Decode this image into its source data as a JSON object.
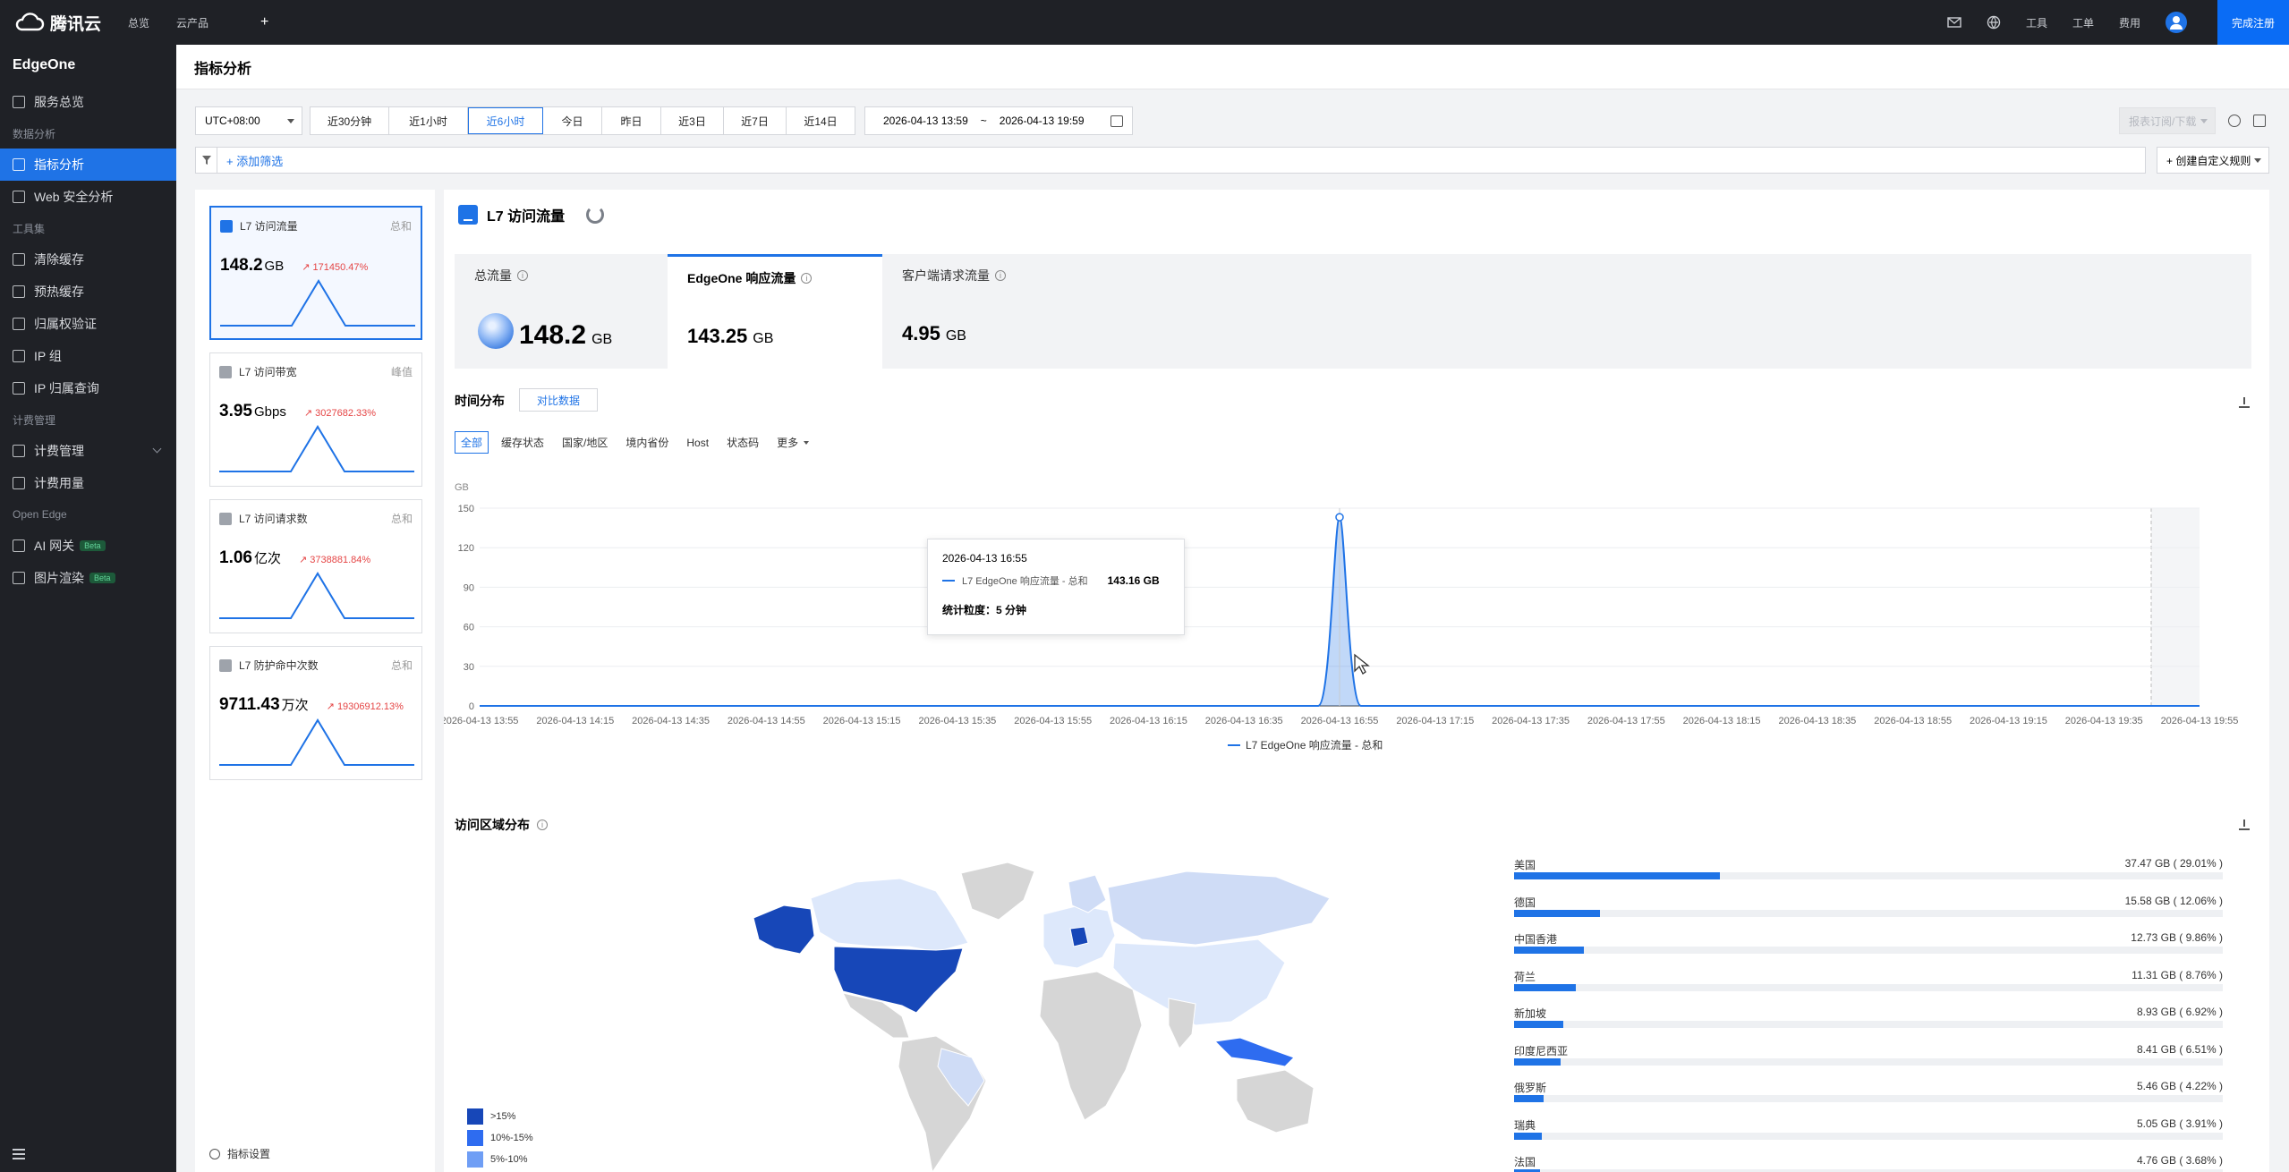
{
  "topbar": {
    "brand": "腾讯云",
    "nav": [
      "总览",
      "云产品"
    ],
    "plus": "+",
    "right_items": [
      "工具",
      "工单",
      "费用"
    ],
    "register_label": "完成注册",
    "icons": [
      "mail-icon",
      "globe-icon",
      "avatar-icon"
    ]
  },
  "sidebar": {
    "product": "EdgeOne",
    "items": [
      {
        "type": "item",
        "label": "服务总览",
        "icon": "grid-icon"
      },
      {
        "type": "group",
        "label": "数据分析"
      },
      {
        "type": "item",
        "label": "指标分析",
        "icon": "monitor-icon",
        "active": true
      },
      {
        "type": "item",
        "label": "Web 安全分析",
        "icon": "shield-icon"
      },
      {
        "type": "group",
        "label": "工具集"
      },
      {
        "type": "item",
        "label": "清除缓存",
        "icon": "clear-cache-icon"
      },
      {
        "type": "item",
        "label": "预热缓存",
        "icon": "prefetch-icon"
      },
      {
        "type": "item",
        "label": "归属权验证",
        "icon": "verify-icon"
      },
      {
        "type": "item",
        "label": "IP 组",
        "icon": "ip-group-icon"
      },
      {
        "type": "item",
        "label": "IP 归属查询",
        "icon": "search-icon"
      },
      {
        "type": "group",
        "label": "计费管理"
      },
      {
        "type": "item",
        "label": "计费管理",
        "icon": "billing-icon",
        "expandable": true
      },
      {
        "type": "item",
        "label": "计费用量",
        "icon": "usage-icon"
      },
      {
        "type": "group",
        "label": "Open Edge"
      },
      {
        "type": "item",
        "label": "AI 网关",
        "icon": "ai-gateway-icon",
        "badge": "Beta"
      },
      {
        "type": "item",
        "label": "图片渲染",
        "icon": "image-render-icon",
        "badge": "Beta"
      }
    ]
  },
  "page": {
    "title": "指标分析"
  },
  "filters": {
    "timezone": "UTC+08:00",
    "ranges": [
      "近30分钟",
      "近1小时",
      "近6小时",
      "今日",
      "昨日",
      "近3日",
      "近7日",
      "近14日"
    ],
    "active_range": "近6小时",
    "date_start": "2026-04-13 13:59",
    "date_sep": "~",
    "date_end": "2026-04-13 19:59",
    "export_label": "报表订阅/下载",
    "add_filter_label": "添加筛选",
    "custom_rule_label": "+ 创建自定义规则"
  },
  "metric_cards": [
    {
      "title": "L7 访问流量",
      "agg": "总和",
      "value": "148.2",
      "unit": "GB",
      "delta": "171450.47%",
      "active": true
    },
    {
      "title": "L7 访问带宽",
      "agg": "峰值",
      "value": "3.95",
      "unit": "Gbps",
      "delta": "3027682.33%"
    },
    {
      "title": "L7 访问请求数",
      "agg": "总和",
      "value": "1.06",
      "unit": "亿次",
      "delta": "3738881.84%"
    },
    {
      "title": "L7 防护命中次数",
      "agg": "总和",
      "value": "9711.43",
      "unit": "万次",
      "delta": "19306912.13%"
    }
  ],
  "cards_footer": "指标设置",
  "main": {
    "title": "L7 访问流量",
    "summary": [
      {
        "label": "总流量",
        "value": "148.2",
        "unit": "GB"
      },
      {
        "label": "EdgeOne 响应流量",
        "value": "143.25",
        "unit": "GB",
        "active": true
      },
      {
        "label": "客户端请求流量",
        "value": "4.95",
        "unit": "GB"
      }
    ],
    "time_section_title": "时间分布",
    "compare_label": "对比数据",
    "dimension_tabs": [
      "全部",
      "缓存状态",
      "国家/地区",
      "境内省份",
      "Host",
      "状态码"
    ],
    "more_label": "更多",
    "region_section_title": "访问区域分布"
  },
  "chart_data": {
    "type": "line",
    "ylabel": "GB",
    "ylim": [
      0,
      150
    ],
    "yticks": [
      0,
      30,
      60,
      90,
      120,
      150
    ],
    "x": [
      "2026-04-13 13:55",
      "2026-04-13 14:15",
      "2026-04-13 14:35",
      "2026-04-13 14:55",
      "2026-04-13 15:15",
      "2026-04-13 15:35",
      "2026-04-13 15:55",
      "2026-04-13 16:15",
      "2026-04-13 16:35",
      "2026-04-13 16:55",
      "2026-04-13 17:15",
      "2026-04-13 17:35",
      "2026-04-13 17:55",
      "2026-04-13 18:15",
      "2026-04-13 18:35",
      "2026-04-13 18:55",
      "2026-04-13 19:15",
      "2026-04-13 19:35",
      "2026-04-13 19:55"
    ],
    "series": [
      {
        "name": "L7 EdgeOne 响应流量 - 总和",
        "values": [
          0,
          0,
          0,
          0,
          0,
          0,
          0,
          0,
          0,
          143.16,
          0,
          0,
          0,
          0,
          0,
          0,
          0,
          0,
          0
        ]
      }
    ],
    "tooltip": {
      "time": "2026-04-13 16:55",
      "series": "L7 EdgeOne 响应流量 - 总和",
      "value": "143.16 GB",
      "granularity": "统计粒度：5 分钟"
    },
    "legend": "L7 EdgeOne 响应流量 - 总和"
  },
  "map_legend": [
    {
      "label": ">15%",
      "color": "#1747b8"
    },
    {
      "label": "10%-15%",
      "color": "#2e6cf0"
    },
    {
      "label": "5%-10%",
      "color": "#6f9ef5"
    }
  ],
  "regions": [
    {
      "name": "美国",
      "value": "37.47 GB ( 29.01% )",
      "pct": 29.01
    },
    {
      "name": "德国",
      "value": "15.58 GB ( 12.06% )",
      "pct": 12.06
    },
    {
      "name": "中国香港",
      "value": "12.73 GB ( 9.86% )",
      "pct": 9.86
    },
    {
      "name": "荷兰",
      "value": "11.31 GB ( 8.76% )",
      "pct": 8.76
    },
    {
      "name": "新加坡",
      "value": "8.93 GB ( 6.92% )",
      "pct": 6.92
    },
    {
      "name": "印度尼西亚",
      "value": "8.41 GB ( 6.51% )",
      "pct": 6.51
    },
    {
      "name": "俄罗斯",
      "value": "5.46 GB ( 4.22% )",
      "pct": 4.22
    },
    {
      "name": "瑞典",
      "value": "5.05 GB ( 3.91% )",
      "pct": 3.91
    },
    {
      "name": "法国",
      "value": "4.76 GB ( 3.68% )",
      "pct": 3.68
    }
  ],
  "colors": {
    "accent": "#1f73e6",
    "topbar": "#1f2126",
    "delta_up": "#e54545"
  }
}
